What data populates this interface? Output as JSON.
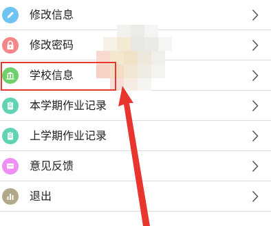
{
  "menu": {
    "items": [
      {
        "label": "修改信息",
        "icon": "pencil-icon",
        "color": "#6fc3f3"
      },
      {
        "label": "修改密码",
        "icon": "lock-icon",
        "color": "#f4868a"
      },
      {
        "label": "学校信息",
        "icon": "school-icon",
        "color": "#6ed06a"
      },
      {
        "label": "本学期作业记录",
        "icon": "clipboard-icon",
        "color": "#5fd3b4"
      },
      {
        "label": "上学期作业记录",
        "icon": "clipboard-icon",
        "color": "#5fd3b4"
      },
      {
        "label": "意见反馈",
        "icon": "feedback-icon",
        "color": "#ef8ef5"
      },
      {
        "label": "退出",
        "icon": "exit-icon",
        "color": "#b1a98a"
      }
    ]
  },
  "annotation": {
    "highlight_color": "#e8362f",
    "highlighted_item": "学校信息"
  }
}
